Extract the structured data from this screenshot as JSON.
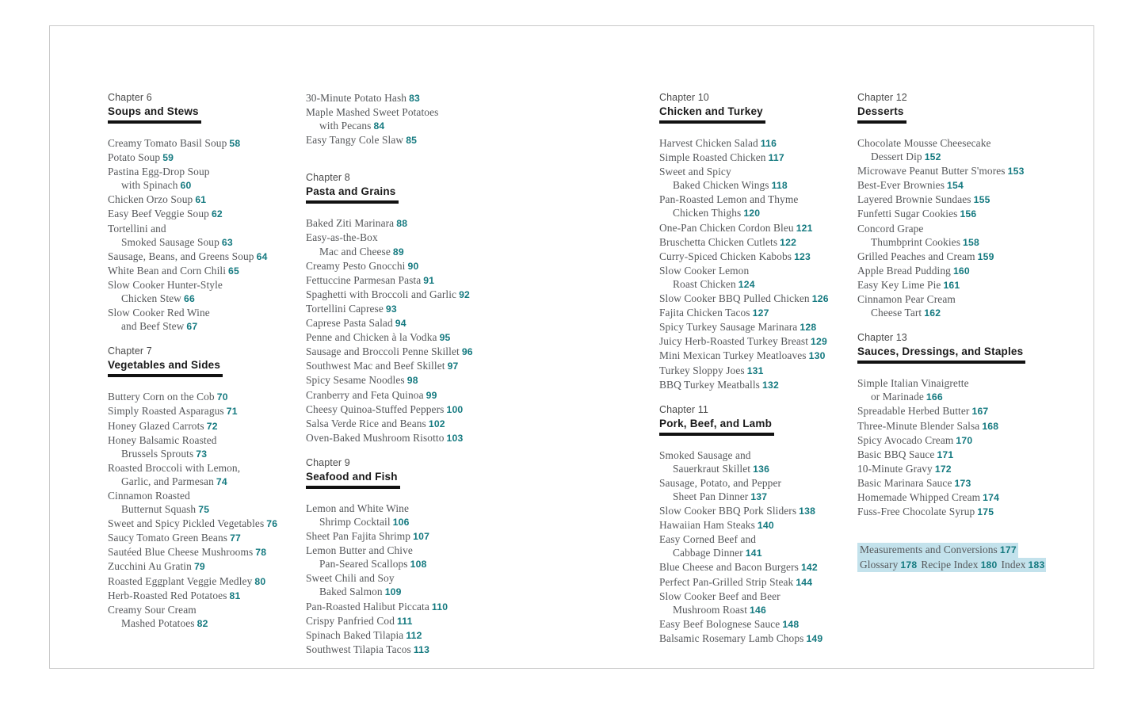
{
  "page": {
    "title": "Cookbook Table of Contents",
    "accent_teal": "#157a80",
    "highlight_blue": "#c3e2ec",
    "body_gray": "#55575a",
    "rule_black": "#111111"
  },
  "columns": [
    {
      "chapters": [
        {
          "kicker": "Chapter 6",
          "title": "Soups and Stews",
          "entries": [
            {
              "lines": [
                "Creamy Tomato Basil Soup"
              ],
              "page": "58"
            },
            {
              "lines": [
                "Potato Soup"
              ],
              "page": "59"
            },
            {
              "lines": [
                "Pastina Egg-Drop Soup",
                "with Spinach"
              ],
              "page": "60"
            },
            {
              "lines": [
                "Chicken Orzo Soup"
              ],
              "page": "61"
            },
            {
              "lines": [
                "Easy Beef Veggie Soup"
              ],
              "page": "62"
            },
            {
              "lines": [
                "Tortellini and",
                "Smoked Sausage Soup"
              ],
              "page": "63"
            },
            {
              "lines": [
                "Sausage, Beans, and Greens Soup"
              ],
              "page": "64"
            },
            {
              "lines": [
                "White Bean and Corn Chili"
              ],
              "page": "65"
            },
            {
              "lines": [
                "Slow Cooker Hunter-Style",
                "Chicken Stew"
              ],
              "page": "66"
            },
            {
              "lines": [
                "Slow Cooker Red Wine",
                "and Beef Stew"
              ],
              "page": "67"
            }
          ]
        },
        {
          "kicker": "Chapter 7",
          "title": "Vegetables and Sides",
          "entries": [
            {
              "lines": [
                "Buttery Corn on the Cob"
              ],
              "page": "70"
            },
            {
              "lines": [
                "Simply Roasted Asparagus"
              ],
              "page": "71"
            },
            {
              "lines": [
                "Honey Glazed Carrots"
              ],
              "page": "72"
            },
            {
              "lines": [
                "Honey Balsamic Roasted",
                "Brussels Sprouts"
              ],
              "page": "73"
            },
            {
              "lines": [
                "Roasted Broccoli with Lemon,",
                "Garlic, and Parmesan"
              ],
              "page": "74"
            },
            {
              "lines": [
                "Cinnamon Roasted",
                "Butternut Squash"
              ],
              "page": "75"
            },
            {
              "lines": [
                "Sweet and Spicy Pickled Vegetables"
              ],
              "page": "76"
            },
            {
              "lines": [
                "Saucy Tomato Green Beans"
              ],
              "page": "77"
            },
            {
              "lines": [
                "Sautéed Blue Cheese Mushrooms"
              ],
              "page": "78"
            },
            {
              "lines": [
                "Zucchini Au Gratin"
              ],
              "page": "79"
            },
            {
              "lines": [
                "Roasted Eggplant Veggie Medley"
              ],
              "page": "80"
            },
            {
              "lines": [
                "Herb-Roasted Red Potatoes"
              ],
              "page": "81"
            },
            {
              "lines": [
                "Creamy Sour Cream",
                "Mashed Potatoes"
              ],
              "page": "82"
            }
          ]
        }
      ]
    },
    {
      "continued_entries": [
        {
          "lines": [
            "30-Minute Potato Hash"
          ],
          "page": "83"
        },
        {
          "lines": [
            "Maple Mashed Sweet Potatoes",
            "with Pecans"
          ],
          "page": "84"
        },
        {
          "lines": [
            "Easy Tangy Cole Slaw"
          ],
          "page": "85"
        }
      ],
      "chapters": [
        {
          "kicker": "Chapter 8",
          "title": "Pasta and Grains",
          "entries": [
            {
              "lines": [
                "Baked Ziti Marinara"
              ],
              "page": "88"
            },
            {
              "lines": [
                "Easy-as-the-Box",
                "Mac and Cheese"
              ],
              "page": "89"
            },
            {
              "lines": [
                "Creamy Pesto Gnocchi"
              ],
              "page": "90"
            },
            {
              "lines": [
                "Fettuccine Parmesan Pasta"
              ],
              "page": "91"
            },
            {
              "lines": [
                "Spaghetti with Broccoli and Garlic"
              ],
              "page": "92"
            },
            {
              "lines": [
                "Tortellini Caprese"
              ],
              "page": "93"
            },
            {
              "lines": [
                "Caprese Pasta Salad"
              ],
              "page": "94"
            },
            {
              "lines": [
                "Penne and Chicken à la Vodka"
              ],
              "page": "95"
            },
            {
              "lines": [
                "Sausage and Broccoli Penne Skillet"
              ],
              "page": "96"
            },
            {
              "lines": [
                "Southwest Mac and Beef Skillet"
              ],
              "page": "97"
            },
            {
              "lines": [
                "Spicy Sesame Noodles"
              ],
              "page": "98"
            },
            {
              "lines": [
                "Cranberry and Feta Quinoa"
              ],
              "page": "99"
            },
            {
              "lines": [
                "Cheesy Quinoa-Stuffed Peppers"
              ],
              "page": "100"
            },
            {
              "lines": [
                "Salsa Verde Rice and Beans"
              ],
              "page": "102"
            },
            {
              "lines": [
                "Oven-Baked Mushroom Risotto"
              ],
              "page": "103"
            }
          ]
        },
        {
          "kicker": "Chapter 9",
          "title": "Seafood and Fish",
          "entries": [
            {
              "lines": [
                "Lemon and White Wine",
                "Shrimp Cocktail"
              ],
              "page": "106"
            },
            {
              "lines": [
                "Sheet Pan Fajita Shrimp"
              ],
              "page": "107"
            },
            {
              "lines": [
                "Lemon Butter and Chive",
                "Pan-Seared Scallops"
              ],
              "page": "108"
            },
            {
              "lines": [
                "Sweet Chili and Soy",
                "Baked Salmon"
              ],
              "page": "109"
            },
            {
              "lines": [
                "Pan-Roasted Halibut Piccata"
              ],
              "page": "110"
            },
            {
              "lines": [
                "Crispy Panfried Cod"
              ],
              "page": "111"
            },
            {
              "lines": [
                "Spinach Baked Tilapia"
              ],
              "page": "112"
            },
            {
              "lines": [
                "Southwest Tilapia Tacos"
              ],
              "page": "113"
            }
          ]
        }
      ]
    },
    {
      "chapters": [
        {
          "kicker": "Chapter 10",
          "title": "Chicken and Turkey",
          "entries": [
            {
              "lines": [
                "Harvest Chicken Salad"
              ],
              "page": "116"
            },
            {
              "lines": [
                "Simple Roasted Chicken"
              ],
              "page": "117"
            },
            {
              "lines": [
                "Sweet and Spicy",
                "Baked Chicken Wings"
              ],
              "page": "118"
            },
            {
              "lines": [
                "Pan-Roasted Lemon and Thyme",
                "Chicken Thighs"
              ],
              "page": "120"
            },
            {
              "lines": [
                "One-Pan Chicken Cordon Bleu"
              ],
              "page": "121"
            },
            {
              "lines": [
                "Bruschetta Chicken Cutlets"
              ],
              "page": "122"
            },
            {
              "lines": [
                "Curry-Spiced Chicken Kabobs"
              ],
              "page": "123"
            },
            {
              "lines": [
                "Slow Cooker Lemon",
                "Roast Chicken"
              ],
              "page": "124"
            },
            {
              "lines": [
                "Slow Cooker BBQ Pulled Chicken"
              ],
              "page": "126"
            },
            {
              "lines": [
                "Fajita Chicken Tacos"
              ],
              "page": "127"
            },
            {
              "lines": [
                "Spicy Turkey Sausage Marinara"
              ],
              "page": "128"
            },
            {
              "lines": [
                "Juicy Herb-Roasted Turkey Breast"
              ],
              "page": "129"
            },
            {
              "lines": [
                "Mini Mexican Turkey Meatloaves"
              ],
              "page": "130"
            },
            {
              "lines": [
                "Turkey Sloppy Joes"
              ],
              "page": "131"
            },
            {
              "lines": [
                "BBQ Turkey Meatballs"
              ],
              "page": "132"
            }
          ]
        },
        {
          "kicker": "Chapter 11",
          "title": "Pork, Beef, and Lamb",
          "entries": [
            {
              "lines": [
                "Smoked Sausage and",
                "Sauerkraut Skillet"
              ],
              "page": "136"
            },
            {
              "lines": [
                "Sausage, Potato, and Pepper",
                "Sheet Pan Dinner"
              ],
              "page": "137"
            },
            {
              "lines": [
                "Slow Cooker BBQ Pork Sliders"
              ],
              "page": "138"
            },
            {
              "lines": [
                "Hawaiian Ham Steaks"
              ],
              "page": "140"
            },
            {
              "lines": [
                "Easy Corned Beef and",
                "Cabbage Dinner"
              ],
              "page": "141"
            },
            {
              "lines": [
                "Blue Cheese and Bacon Burgers"
              ],
              "page": "142"
            },
            {
              "lines": [
                "Perfect Pan-Grilled Strip Steak"
              ],
              "page": "144"
            },
            {
              "lines": [
                "Slow Cooker Beef and Beer",
                "Mushroom Roast"
              ],
              "page": "146"
            },
            {
              "lines": [
                "Easy Beef Bolognese Sauce"
              ],
              "page": "148"
            },
            {
              "lines": [
                "Balsamic Rosemary Lamb Chops"
              ],
              "page": "149"
            }
          ]
        }
      ]
    },
    {
      "chapters": [
        {
          "kicker": "Chapter 12",
          "title": "Desserts",
          "entries": [
            {
              "lines": [
                "Chocolate Mousse Cheesecake",
                "Dessert Dip"
              ],
              "page": "152"
            },
            {
              "lines": [
                "Microwave Peanut Butter S'mores"
              ],
              "page": "153"
            },
            {
              "lines": [
                "Best-Ever Brownies"
              ],
              "page": "154"
            },
            {
              "lines": [
                "Layered Brownie Sundaes"
              ],
              "page": "155"
            },
            {
              "lines": [
                "Funfetti Sugar Cookies"
              ],
              "page": "156"
            },
            {
              "lines": [
                "Concord Grape",
                "Thumbprint Cookies"
              ],
              "page": "158"
            },
            {
              "lines": [
                "Grilled Peaches and Cream"
              ],
              "page": "159"
            },
            {
              "lines": [
                "Apple Bread Pudding"
              ],
              "page": "160"
            },
            {
              "lines": [
                "Easy Key Lime Pie"
              ],
              "page": "161"
            },
            {
              "lines": [
                "Cinnamon Pear Cream",
                "Cheese Tart"
              ],
              "page": "162"
            }
          ]
        },
        {
          "kicker": "Chapter 13",
          "title": "Sauces, Dressings, and Staples",
          "entries": [
            {
              "lines": [
                "Simple Italian Vinaigrette",
                "or Marinade"
              ],
              "page": "166"
            },
            {
              "lines": [
                "Spreadable Herbed Butter"
              ],
              "page": "167"
            },
            {
              "lines": [
                "Three-Minute Blender Salsa"
              ],
              "page": "168"
            },
            {
              "lines": [
                "Spicy Avocado Cream"
              ],
              "page": "170"
            },
            {
              "lines": [
                "Basic BBQ Sauce"
              ],
              "page": "171"
            },
            {
              "lines": [
                "10-Minute Gravy"
              ],
              "page": "172"
            },
            {
              "lines": [
                "Basic Marinara Sauce"
              ],
              "page": "173"
            },
            {
              "lines": [
                "Homemade Whipped Cream"
              ],
              "page": "174"
            },
            {
              "lines": [
                "Fuss-Free Chocolate Syrup"
              ],
              "page": "175"
            }
          ]
        }
      ],
      "backmatter": [
        {
          "lines": [
            "Measurements and Conversions"
          ],
          "page": "177"
        },
        {
          "lines": [
            "Glossary"
          ],
          "page": "178"
        },
        {
          "lines": [
            "Recipe Index"
          ],
          "page": "180"
        },
        {
          "lines": [
            "Index"
          ],
          "page": "183"
        }
      ]
    }
  ]
}
